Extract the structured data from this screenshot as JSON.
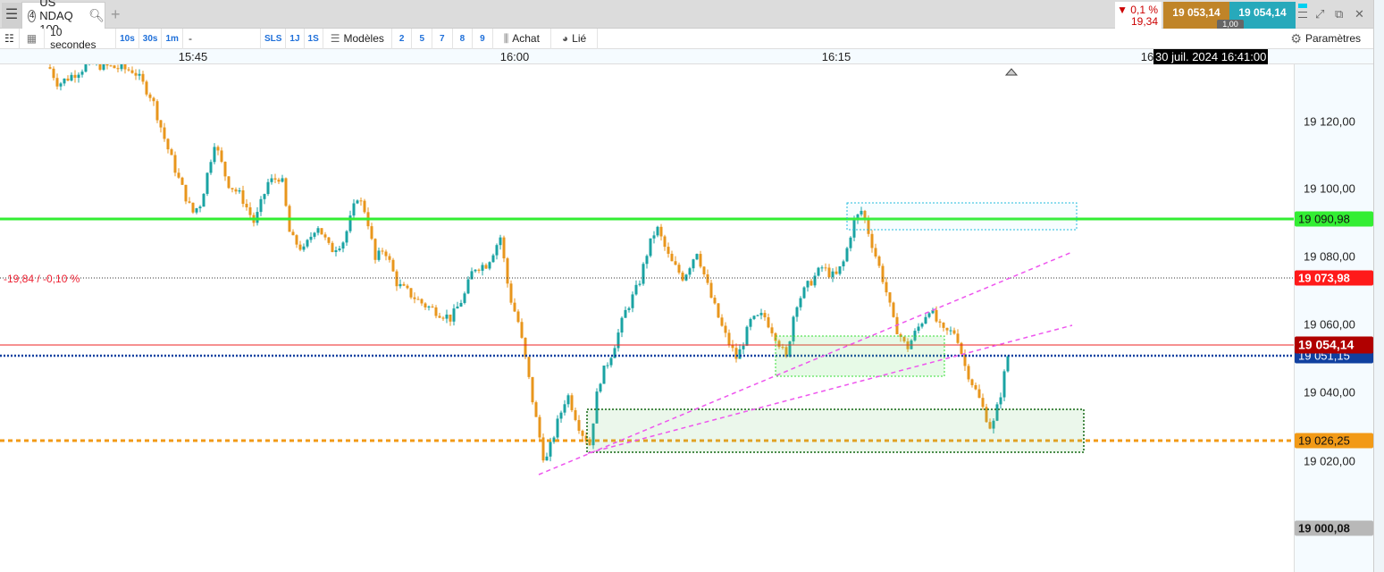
{
  "tabbar": {
    "menu_icon": "hamburger-icon",
    "tab_number": "4",
    "tab_title": "US NDAQ 100",
    "search_icon": "search-icon",
    "add_icon": "plus-icon"
  },
  "quote": {
    "change_pct": "▼ 0,1 %",
    "change_abs": "19,34",
    "bid": "19 053,14",
    "ask": "19 054,14",
    "spread": "1,00",
    "bid_color": "#c08428",
    "ask_color": "#27a9bb"
  },
  "window": {
    "maximize": "⤢",
    "popout": "⧉",
    "close": "✕"
  },
  "toolbar": {
    "interval": "10 secondes",
    "quick_intervals": [
      "10s",
      "30s",
      "1m"
    ],
    "dash": "-",
    "ranges": [
      "SLS",
      "1J",
      "1S"
    ],
    "models_label": "Modèles",
    "model_slots": [
      "2",
      "5",
      "7",
      "8",
      "9"
    ],
    "buy_label": "Achat",
    "linked_label": "Lié",
    "settings_label": "Paramètres"
  },
  "time_axis": {
    "labels": [
      "15:45",
      "16:00",
      "16:15",
      "16"
    ],
    "cursor_date": "30 juil. 2024 16:41:00"
  },
  "price_axis": {
    "labels": [
      "19 120,00",
      "19 100,00",
      "19 080,00",
      "19 060,00",
      "19 040,00",
      "19 020,00"
    ],
    "tags": {
      "green_line": "19 090,98",
      "prev_close": "19 073,98",
      "ask": "19 054,14",
      "bid": "19 051,15",
      "orange_line": "19 026,25",
      "low": "19 000,08"
    }
  },
  "change_label": "-19,84 / -0,10 %",
  "colors": {
    "up": "#1aa3a3",
    "down": "#e8961c",
    "green_line": "#33ee33",
    "prev_close": "#ff1a1a",
    "ask": "#b00000",
    "bid": "#1040a0",
    "orange": "#f29a16",
    "trend": "#ee55ee"
  },
  "chart_data": {
    "type": "candlestick",
    "interval": "10 seconds",
    "symbol": "US NDAQ 100",
    "close_path": [
      [
        "15:38:18",
        19136
      ],
      [
        "15:38:43",
        19131
      ],
      [
        "15:40:10",
        19137
      ],
      [
        "15:42:15",
        19135
      ],
      [
        "15:43:05",
        19127
      ],
      [
        "15:43:43",
        19114
      ],
      [
        "15:44:20",
        19103
      ],
      [
        "15:44:58",
        19093
      ],
      [
        "15:45:22",
        19096
      ],
      [
        "15:46:00",
        19114
      ],
      [
        "15:46:37",
        19102
      ],
      [
        "15:47:15",
        19098
      ],
      [
        "15:47:52",
        19090
      ],
      [
        "15:48:30",
        19102
      ],
      [
        "15:49:07",
        19104
      ],
      [
        "15:49:32",
        19086
      ],
      [
        "15:50:10",
        19082
      ],
      [
        "15:50:47",
        19090
      ],
      [
        "15:51:25",
        19082
      ],
      [
        "15:52:02",
        19085
      ],
      [
        "15:52:40",
        19098
      ],
      [
        "15:53:05",
        19093
      ],
      [
        "15:53:30",
        19079
      ],
      [
        "15:53:55",
        19083
      ],
      [
        "15:54:32",
        19072
      ],
      [
        "15:55:10",
        19069
      ],
      [
        "15:55:47",
        19066
      ],
      [
        "15:56:25",
        19064
      ],
      [
        "15:57:02",
        19062
      ],
      [
        "15:57:40",
        19069
      ],
      [
        "15:58:05",
        19077
      ],
      [
        "15:58:42",
        19078
      ],
      [
        "15:59:20",
        19086
      ],
      [
        "15:59:45",
        19069
      ],
      [
        "16:00:10",
        19061
      ],
      [
        "16:00:30",
        19050
      ],
      [
        "16:00:55",
        19035
      ],
      [
        "16:01:25",
        19019
      ],
      [
        "16:02:02",
        19032
      ],
      [
        "16:02:27",
        19040
      ],
      [
        "16:03:05",
        19029
      ],
      [
        "16:03:30",
        19025
      ],
      [
        "16:03:55",
        19043
      ],
      [
        "16:04:32",
        19052
      ],
      [
        "16:05:10",
        19064
      ],
      [
        "16:05:47",
        19072
      ],
      [
        "16:06:12",
        19082
      ],
      [
        "16:06:37",
        19089
      ],
      [
        "16:07:15",
        19079
      ],
      [
        "16:07:52",
        19074
      ],
      [
        "16:08:30",
        19082
      ],
      [
        "16:09:07",
        19069
      ],
      [
        "16:09:45",
        19058
      ],
      [
        "16:10:22",
        19050
      ],
      [
        "16:11:00",
        19061
      ],
      [
        "16:11:37",
        19063
      ],
      [
        "16:12:15",
        19056
      ],
      [
        "16:12:40",
        19050
      ],
      [
        "16:13:05",
        19066
      ],
      [
        "16:13:42",
        19072
      ],
      [
        "16:14:20",
        19077
      ],
      [
        "16:14:57",
        19074
      ],
      [
        "16:15:22",
        19079
      ],
      [
        "16:15:47",
        19090
      ],
      [
        "16:16:12",
        19094
      ],
      [
        "16:16:37",
        19085
      ],
      [
        "16:17:15",
        19072
      ],
      [
        "16:17:40",
        19061
      ],
      [
        "16:18:17",
        19053
      ],
      [
        "16:18:42",
        19058
      ],
      [
        "16:19:20",
        19065
      ],
      [
        "16:19:57",
        19058
      ],
      [
        "16:20:35",
        19058
      ],
      [
        "16:21:00",
        19048
      ],
      [
        "16:21:37",
        19039
      ],
      [
        "16:22:15",
        19029
      ],
      [
        "16:22:40",
        19040
      ],
      [
        "16:23:00",
        19051
      ]
    ]
  }
}
